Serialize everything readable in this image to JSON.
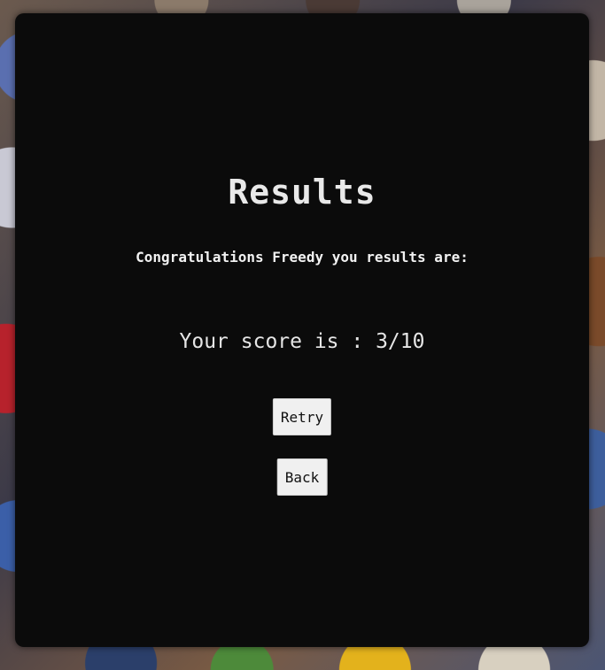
{
  "results": {
    "title": "Results",
    "congratulations": "Congratulations Freedy you results are:",
    "score_text": "Your score is : 3/10"
  },
  "buttons": {
    "retry": "Retry",
    "back": "Back"
  },
  "colors": {
    "card_background": "#0b0b0b",
    "text": "#e9e9e9",
    "button_background": "#f0f0f0"
  }
}
